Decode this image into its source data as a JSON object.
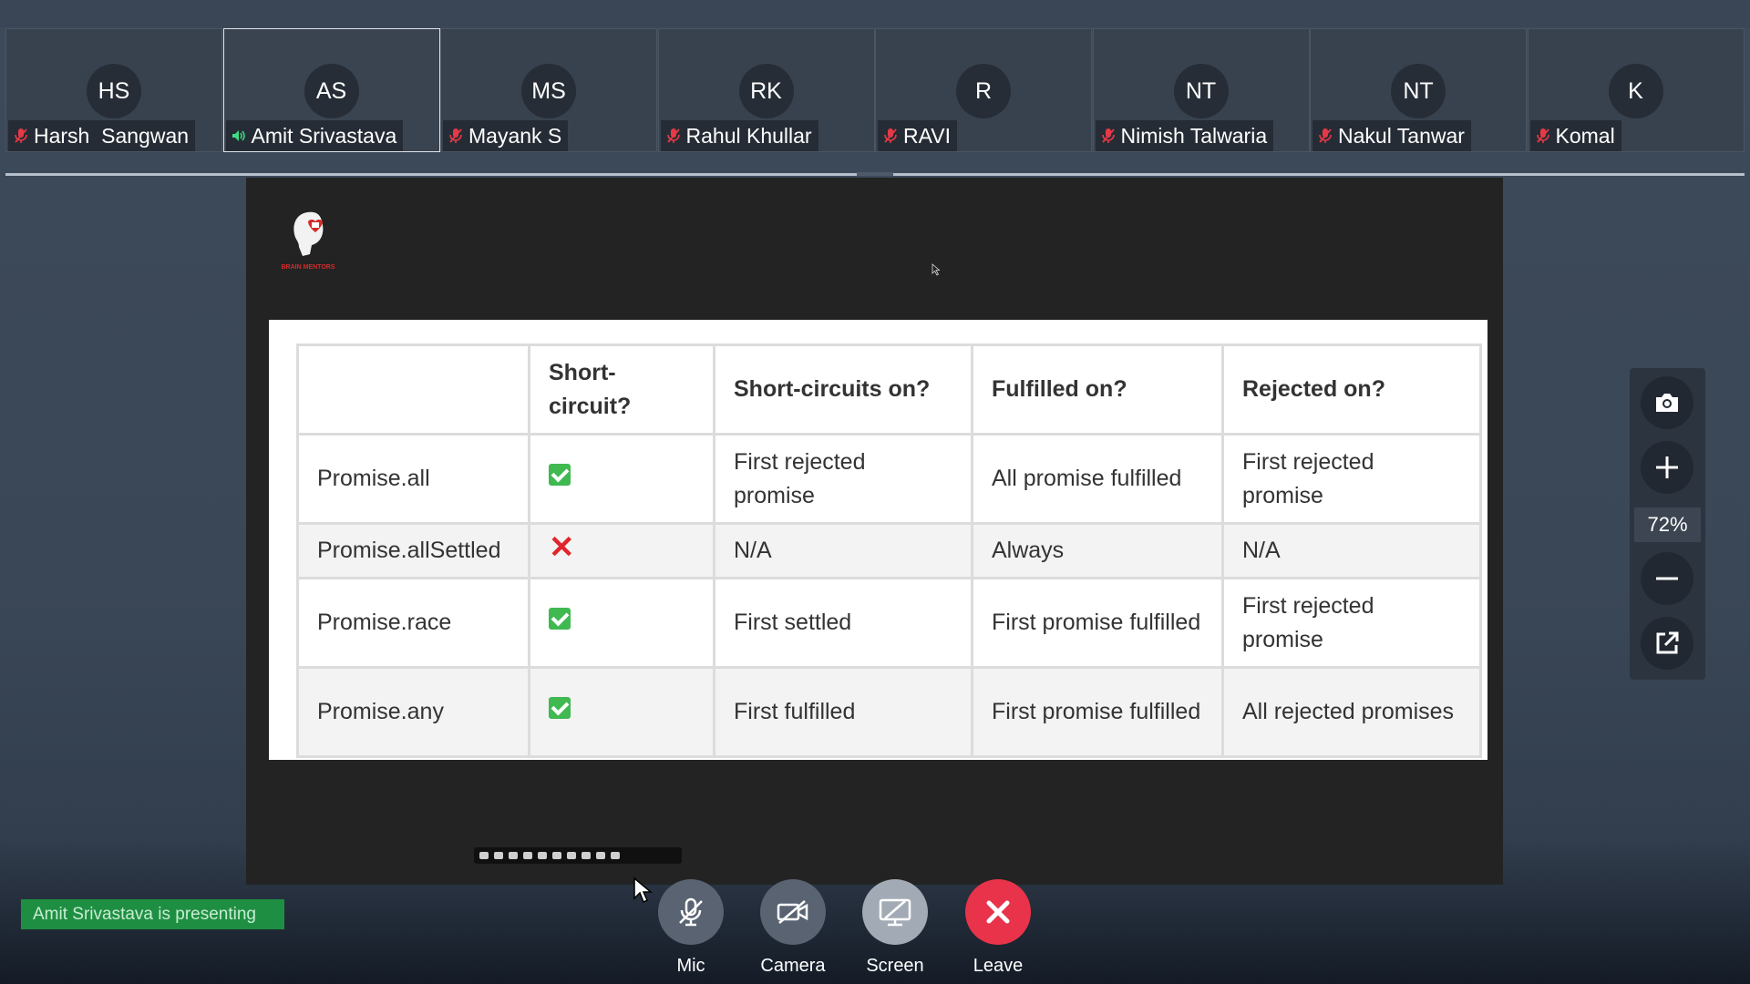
{
  "participants": [
    {
      "initials": "HS",
      "name": "Harsh  Sangwan",
      "mic": "muted"
    },
    {
      "initials": "AS",
      "name": "Amit Srivastava",
      "mic": "speaking",
      "active": true
    },
    {
      "initials": "MS",
      "name": "Mayank S",
      "mic": "muted"
    },
    {
      "initials": "RK",
      "name": "Rahul Khullar",
      "mic": "muted"
    },
    {
      "initials": "R",
      "name": "RAVI",
      "mic": "muted"
    },
    {
      "initials": "NT",
      "name": "Nimish Talwaria",
      "mic": "muted"
    },
    {
      "initials": "NT",
      "name": "Nakul Tanwar",
      "mic": "muted"
    },
    {
      "initials": "K",
      "name": "Komal",
      "mic": "muted"
    }
  ],
  "slide": {
    "logo_text": "BRAIN MENTORS",
    "headers": [
      "",
      "Short-circuit?",
      "Short-circuits on?",
      "Fulfilled on?",
      "Rejected on?"
    ],
    "rows": [
      {
        "method": "Promise.all",
        "short_circuit": "check",
        "on": "First rejected promise",
        "fulfilled": "All promise fulfilled",
        "rejected": "First rejected promise"
      },
      {
        "method": "Promise.allSettled",
        "short_circuit": "cross",
        "on": "N/A",
        "fulfilled": "Always",
        "rejected": "N/A"
      },
      {
        "method": "Promise.race",
        "short_circuit": "check",
        "on": "First settled",
        "fulfilled": "First promise fulfilled",
        "rejected": "First rejected promise"
      },
      {
        "method": "Promise.any",
        "short_circuit": "check",
        "on": "First fulfilled",
        "fulfilled": "First promise fulfilled",
        "rejected": "All rejected promises"
      }
    ]
  },
  "zoom": {
    "level": "72%",
    "icons": [
      "camera-icon",
      "zoom-in-icon",
      "zoom-out-icon",
      "popout-icon"
    ]
  },
  "status": {
    "presenting": "Amit Srivastava is presenting"
  },
  "controls": {
    "mic": "Mic",
    "camera": "Camera",
    "screen": "Screen",
    "leave": "Leave"
  },
  "colors": {
    "muted_mic": "#e63946",
    "speaking_mic": "#3ddc84",
    "leave": "#e8334a",
    "presenting_bg": "#1e8f42"
  }
}
